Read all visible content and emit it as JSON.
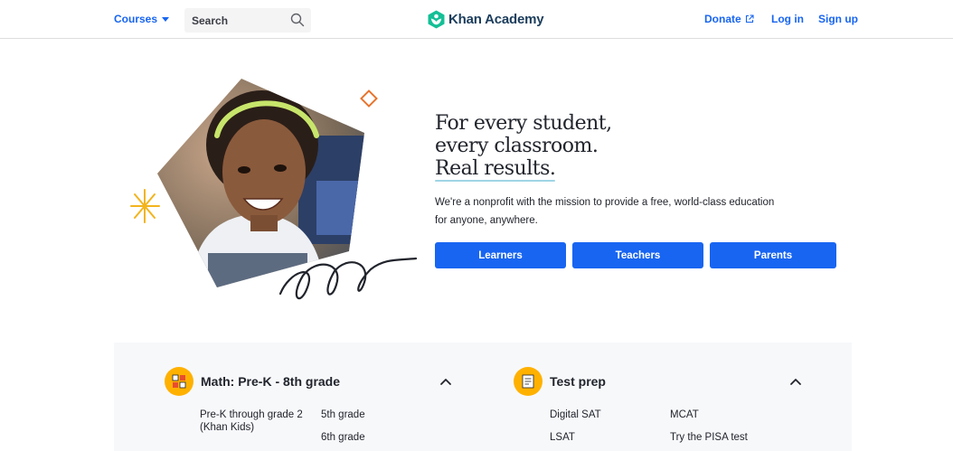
{
  "nav": {
    "courses_label": "Courses",
    "search_placeholder": "Search",
    "brand": "Khan Academy",
    "donate_label": "Donate",
    "login_label": "Log in",
    "signup_label": "Sign up"
  },
  "hero": {
    "headline_line1": "For every student,",
    "headline_line2": "every classroom.",
    "headline_line3": "Real results.",
    "mission_line1": "We're a nonprofit with the mission to provide a free, world-class education",
    "mission_line2": "for anyone, anywhere.",
    "buttons": [
      "Learners",
      "Teachers",
      "Parents"
    ]
  },
  "courses": [
    {
      "title": "Math: Pre-K - 8th grade",
      "icon": "math-blocks-icon",
      "links": [
        "Pre-K through grade 2",
        "(Khan Kids)",
        "5th grade",
        "6th grade"
      ]
    },
    {
      "title": "Test prep",
      "icon": "test-prep-icon",
      "links": [
        "Digital SAT",
        "MCAT",
        "LSAT",
        "Try the PISA test"
      ]
    }
  ],
  "colors": {
    "accent": "#1865f2",
    "brand_green": "#14bf96",
    "course_icon": "#ffb100",
    "panel_bg": "#f7f8fa"
  }
}
